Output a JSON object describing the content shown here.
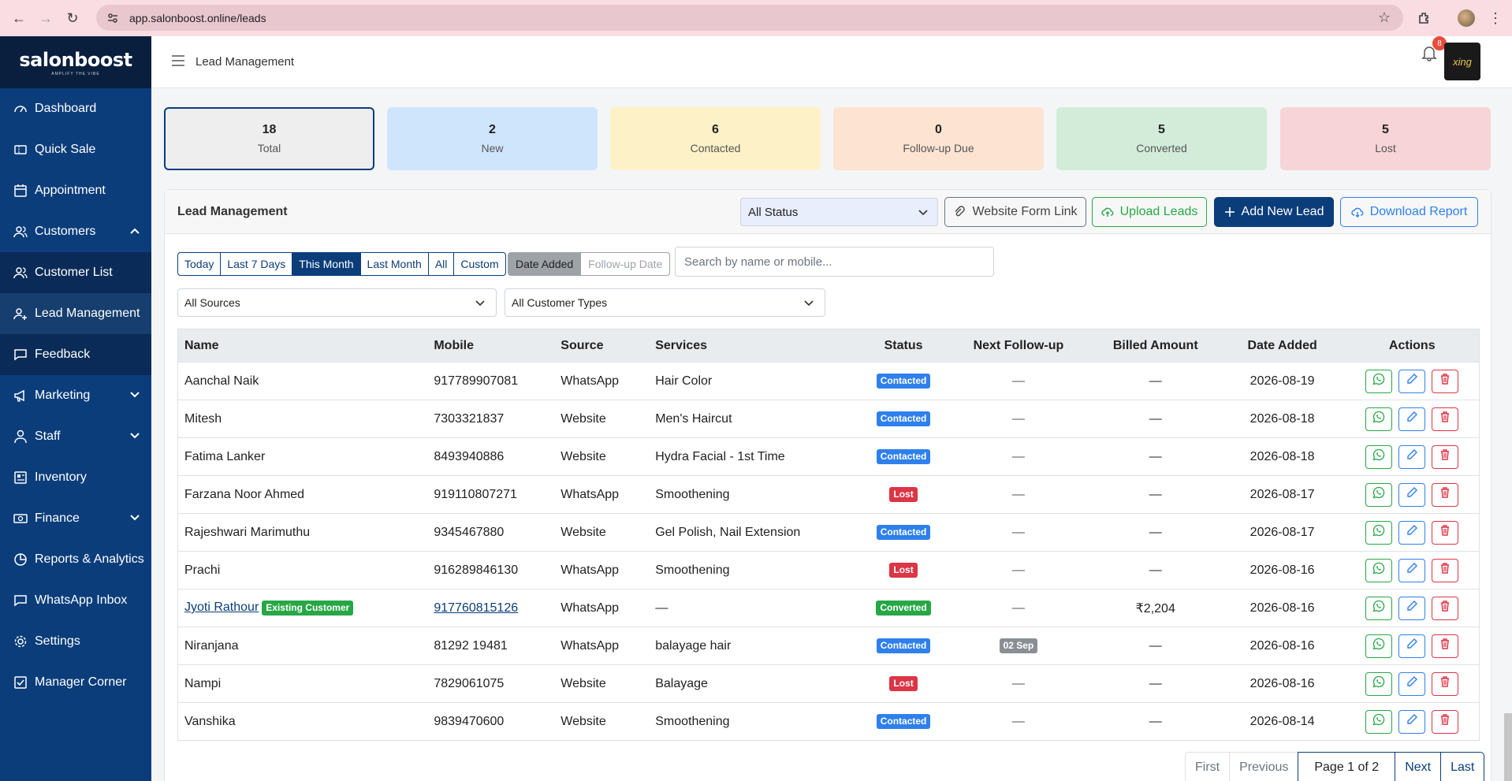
{
  "browser": {
    "url": "app.salonboost.online/leads"
  },
  "sidebar": {
    "logo": "salonboost",
    "tagline": "AMPLIFY THE VIBE",
    "items": [
      {
        "label": "Dashboard",
        "icon": "gauge-icon"
      },
      {
        "label": "Quick Sale",
        "icon": "ticket-icon"
      },
      {
        "label": "Appointment",
        "icon": "calendar-icon"
      },
      {
        "label": "Customers",
        "icon": "users-icon"
      },
      {
        "label": "Customer List",
        "icon": "users-icon"
      },
      {
        "label": "Lead Management",
        "icon": "user-plus-icon"
      },
      {
        "label": "Feedback",
        "icon": "chat-icon"
      },
      {
        "label": "Marketing",
        "icon": "megaphone-icon"
      },
      {
        "label": "Staff",
        "icon": "person-icon"
      },
      {
        "label": "Inventory",
        "icon": "box-icon"
      },
      {
        "label": "Finance",
        "icon": "cash-icon"
      },
      {
        "label": "Reports & Analytics",
        "icon": "chart-icon"
      },
      {
        "label": "WhatsApp Inbox",
        "icon": "chat-icon"
      },
      {
        "label": "Settings",
        "icon": "gear-icon"
      },
      {
        "label": "Manager Corner",
        "icon": "check-square-icon"
      }
    ]
  },
  "header": {
    "title": "Lead Management",
    "notification_count": "8",
    "brand": "xing"
  },
  "stats": [
    {
      "value": "18",
      "label": "Total",
      "bg": "#eeeeee"
    },
    {
      "value": "2",
      "label": "New",
      "bg": "#cfe5fc"
    },
    {
      "value": "6",
      "label": "Contacted",
      "bg": "#fdf1c7"
    },
    {
      "value": "0",
      "label": "Follow-up Due",
      "bg": "#fde3d2"
    },
    {
      "value": "5",
      "label": "Converted",
      "bg": "#d3ecda"
    },
    {
      "value": "5",
      "label": "Lost",
      "bg": "#f7d4d7"
    }
  ],
  "card": {
    "title": "Lead Management",
    "status_filter": "All Status",
    "website_form_link": "Website Form Link",
    "upload_leads": "Upload Leads",
    "add_new_lead": "Add New Lead",
    "download_report": "Download Report",
    "range_filters": [
      "Today",
      "Last 7 Days",
      "This Month",
      "Last Month",
      "All",
      "Custom"
    ],
    "active_range": "This Month",
    "date_type_filters": [
      "Date Added",
      "Follow-up Date"
    ],
    "search_placeholder": "Search by name or mobile...",
    "sources_filter": "All Sources",
    "customer_types_filter": "All Customer Types"
  },
  "table": {
    "columns": [
      "Name",
      "Mobile",
      "Source",
      "Services",
      "Status",
      "Next Follow-up",
      "Billed Amount",
      "Date Added",
      "Actions"
    ],
    "rows": [
      {
        "name": "Aanchal Naik",
        "mobile": "917789907081",
        "source": "WhatsApp",
        "services": "Hair Color",
        "status": "Contacted",
        "followup": "—",
        "billed": "—",
        "date": "2026-08-19"
      },
      {
        "name": "Mitesh",
        "mobile": "7303321837",
        "source": "Website",
        "services": "Men's Haircut",
        "status": "Contacted",
        "followup": "—",
        "billed": "—",
        "date": "2026-08-18"
      },
      {
        "name": "Fatima Lanker",
        "mobile": "8493940886",
        "source": "Website",
        "services": "Hydra Facial - 1st Time",
        "status": "Contacted",
        "followup": "—",
        "billed": "—",
        "date": "2026-08-18"
      },
      {
        "name": "Farzana Noor Ahmed",
        "mobile": "919110807271",
        "source": "WhatsApp",
        "services": "Smoothening",
        "status": "Lost",
        "followup": "—",
        "billed": "—",
        "date": "2026-08-17"
      },
      {
        "name": "Rajeshwari Marimuthu",
        "mobile": "9345467880",
        "source": "Website",
        "services": "Gel Polish, Nail Extension",
        "status": "Contacted",
        "followup": "—",
        "billed": "—",
        "date": "2026-08-17"
      },
      {
        "name": "Prachi",
        "mobile": "916289846130",
        "source": "WhatsApp",
        "services": "Smoothening",
        "status": "Lost",
        "followup": "—",
        "billed": "—",
        "date": "2026-08-16"
      },
      {
        "name": "Jyoti Rathour",
        "tag": "Existing Customer",
        "mobile": "917760815126",
        "source": "WhatsApp",
        "services": "—",
        "status": "Converted",
        "followup": "—",
        "billed": "₹2,204",
        "date": "2026-08-16",
        "link": true
      },
      {
        "name": "Niranjana",
        "mobile": "81292 19481",
        "source": "WhatsApp",
        "services": "balayage hair",
        "status": "Contacted",
        "followup": "02 Sep",
        "followup_badge": true,
        "billed": "—",
        "date": "2026-08-16"
      },
      {
        "name": "Nampi",
        "mobile": "7829061075",
        "source": "Website",
        "services": "Balayage",
        "status": "Lost",
        "followup": "—",
        "billed": "—",
        "date": "2026-08-16"
      },
      {
        "name": "Vanshika",
        "mobile": "9839470600",
        "source": "Website",
        "services": "Smoothening",
        "status": "Contacted",
        "followup": "—",
        "billed": "—",
        "date": "2026-08-14"
      }
    ]
  },
  "pagination": {
    "first": "First",
    "previous": "Previous",
    "current": "Page 1 of 2",
    "next": "Next",
    "last": "Last"
  }
}
